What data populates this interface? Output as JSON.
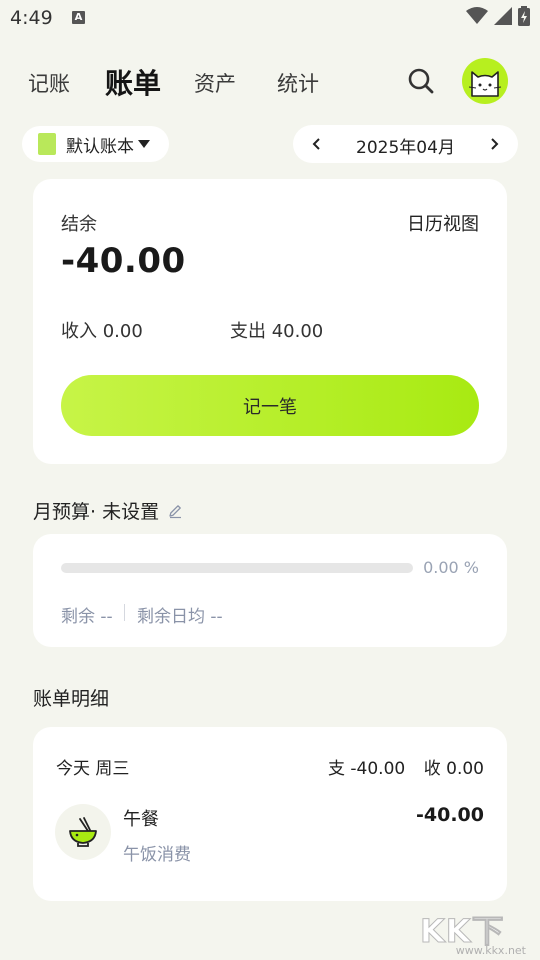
{
  "status_bar": {
    "time": "4:49",
    "notification_icon": "a-icon",
    "icons": [
      "wifi-icon",
      "signal-icon",
      "battery-charging-icon"
    ]
  },
  "nav": {
    "tabs": [
      {
        "label": "记账",
        "active": false
      },
      {
        "label": "账单",
        "active": true
      },
      {
        "label": "资产",
        "active": false
      },
      {
        "label": "统计",
        "active": false
      }
    ],
    "search_icon": "search-icon",
    "avatar_icon": "cat-icon"
  },
  "filters": {
    "book_name": "默认账本",
    "month": "2025年04月"
  },
  "summary": {
    "balance_label": "结余",
    "calendar_view": "日历视图",
    "balance_value": "-40.00",
    "income": "收入 0.00",
    "expense": "支出 40.00",
    "record_button": "记一笔"
  },
  "budget": {
    "title": "月预算· 未设置",
    "progress_percent": 0,
    "progress_text": "0.00 %",
    "remaining": "剩余 --",
    "daily_average": "剩余日均 --"
  },
  "details": {
    "title": "账单明细",
    "day": {
      "label": "今天 周三",
      "expense": "支 -40.00",
      "income": "收 0.00"
    },
    "items": [
      {
        "title": "午餐",
        "note": "午饭消费",
        "amount": "-40.00",
        "icon": "bowl-icon"
      }
    ]
  },
  "watermark": {
    "main": "KK下载",
    "sub": "www.kkx.net"
  },
  "colors": {
    "accent": "#a8ea12",
    "background": "#f4f5ee",
    "muted_text": "#8a93a8"
  }
}
